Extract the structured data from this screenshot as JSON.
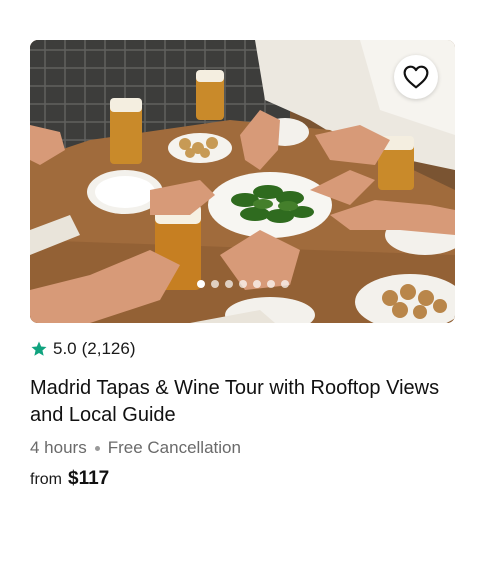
{
  "card": {
    "image_alt": "Group sharing tapas and beers around a wooden table",
    "favorite_icon": "heart-outline-icon",
    "carousel": {
      "count": 7,
      "active_index": 0
    },
    "rating": {
      "icon": "star-icon",
      "star_color": "#10a37f",
      "value": "5.0",
      "count": "(2,126)"
    },
    "title": "Madrid Tapas & Wine Tour with Rooftop Views and Local Guide",
    "duration": "4 hours",
    "cancellation": "Free Cancellation",
    "price_prefix": "from",
    "price": "$117"
  }
}
